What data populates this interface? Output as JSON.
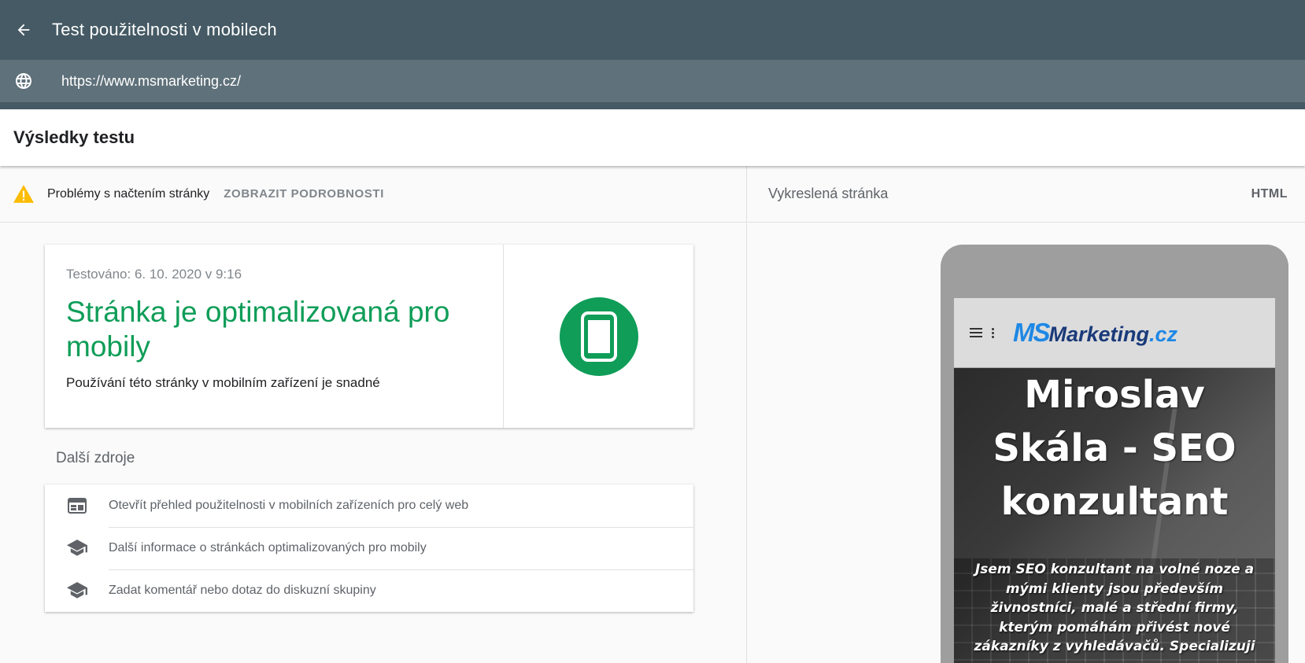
{
  "header": {
    "title": "Test použitelnosti v mobilech",
    "back_icon": "arrow-left-icon"
  },
  "urlbar": {
    "url": "https://www.msmarketing.cz/",
    "globe_icon": "globe-icon"
  },
  "results": {
    "title": "Výsledky testu"
  },
  "issues": {
    "text": "Problémy s načtením stránky",
    "details_link": "ZOBRAZIT PODROBNOSTI",
    "icon": "warning-icon"
  },
  "result_card": {
    "tested": "Testováno: 6. 10. 2020 v 9:16",
    "verdict": "Stránka je optimalizovaná pro mobily",
    "subtitle": "Používání této stránky v mobilním zařízení je snadné",
    "icon": "smartphone-icon"
  },
  "resources": {
    "title": "Další zdroje",
    "items": [
      {
        "label": "Otevřít přehled použitelnosti v mobilních zařízeních pro celý web",
        "icon": "web-icon"
      },
      {
        "label": "Další informace o stránkách optimalizovaných pro mobily",
        "icon": "school-icon"
      },
      {
        "label": "Zadat komentář nebo dotaz do diskuzní skupiny",
        "icon": "school-icon"
      }
    ]
  },
  "rendered": {
    "label": "Vykreslená stránka",
    "html_tab": "HTML"
  },
  "preview": {
    "logo_ms": "MS",
    "logo_rest": "Marketing",
    "logo_cz": ".cz",
    "hero_title_lines": [
      "Miroslav",
      "Skála - SEO",
      "konzultant"
    ],
    "hero_text": "Jsem SEO konzultant na volné noze a mými klienty jsou především živnostníci, malé a střední firmy, kterým pomáhám přivést nové zákazníky z vyhledávačů. Specializuji"
  },
  "colors": {
    "header_bg": "#455a64",
    "urlbar_bg": "#5f717a",
    "success_green": "#0f9d58",
    "warning_yellow": "#fbbc04"
  }
}
